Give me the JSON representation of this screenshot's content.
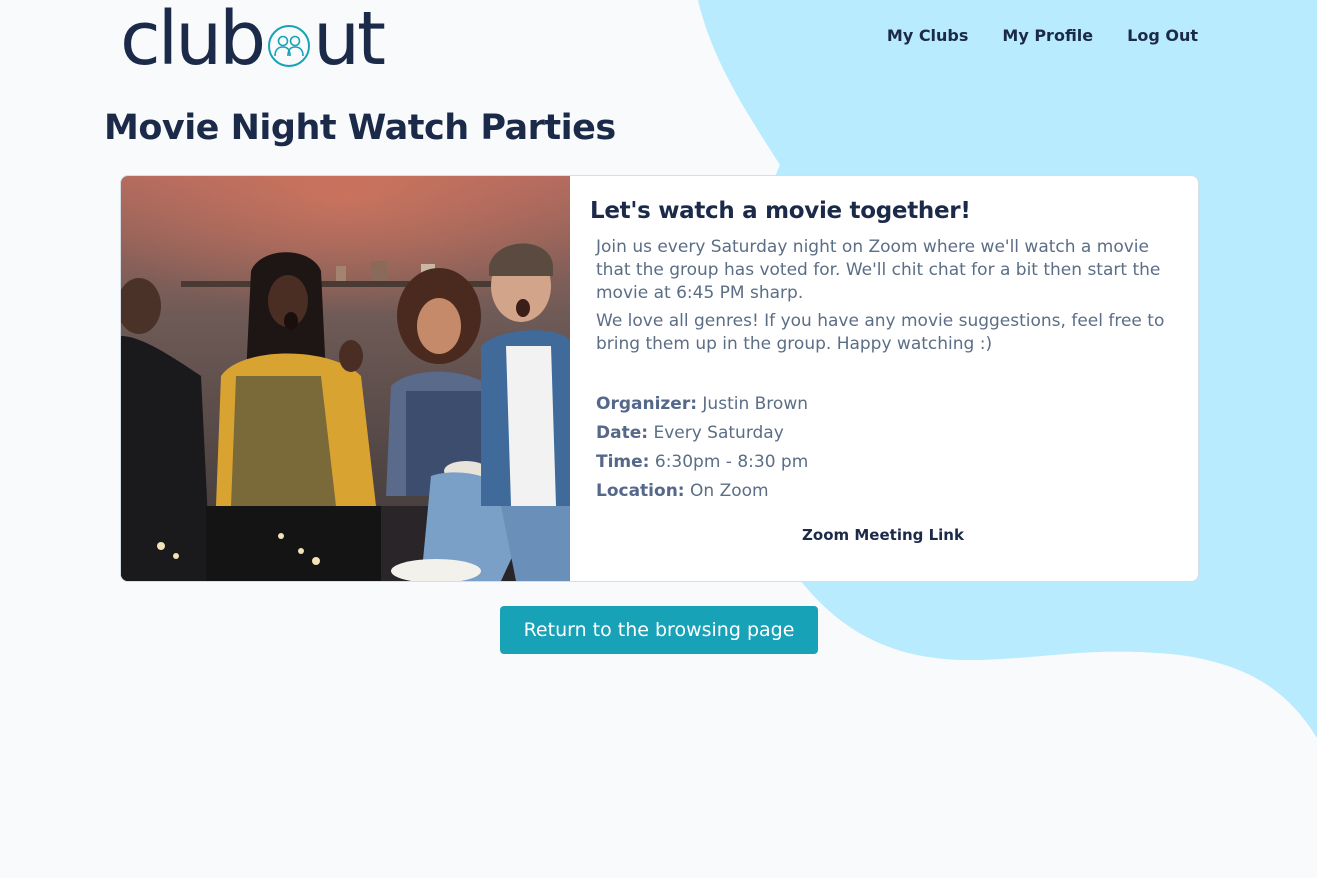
{
  "brand": {
    "logo_left": "club",
    "logo_right": "ut",
    "logo_icon": "people-circle-icon",
    "accent_color": "#17a2b8",
    "blob_color": "#b8ebfd",
    "text_color": "#1c2a4a"
  },
  "nav": {
    "items": [
      {
        "label": "My Clubs"
      },
      {
        "label": "My Profile"
      },
      {
        "label": "Log Out"
      }
    ]
  },
  "page": {
    "title": "Movie Night Watch Parties"
  },
  "event": {
    "photo": "friends-watching-movie-photo",
    "heading": "Let's watch a movie together!",
    "description": [
      "Join us every Saturday night on Zoom where we'll watch a movie that the group has voted for. We'll chit chat for a bit then start the movie at 6:45 PM sharp.",
      "We love all genres! If you have any movie suggestions, feel free to bring them up in the group. Happy watching :)"
    ],
    "details": [
      {
        "label": "Organizer:",
        "value": "Justin Brown"
      },
      {
        "label": "Date:",
        "value": "Every Saturday"
      },
      {
        "label": "Time:",
        "value": "6:30pm - 8:30 pm"
      },
      {
        "label": "Location:",
        "value": "On Zoom"
      }
    ],
    "link_label": "Zoom Meeting Link"
  },
  "actions": {
    "return_label": "Return to the browsing page"
  }
}
